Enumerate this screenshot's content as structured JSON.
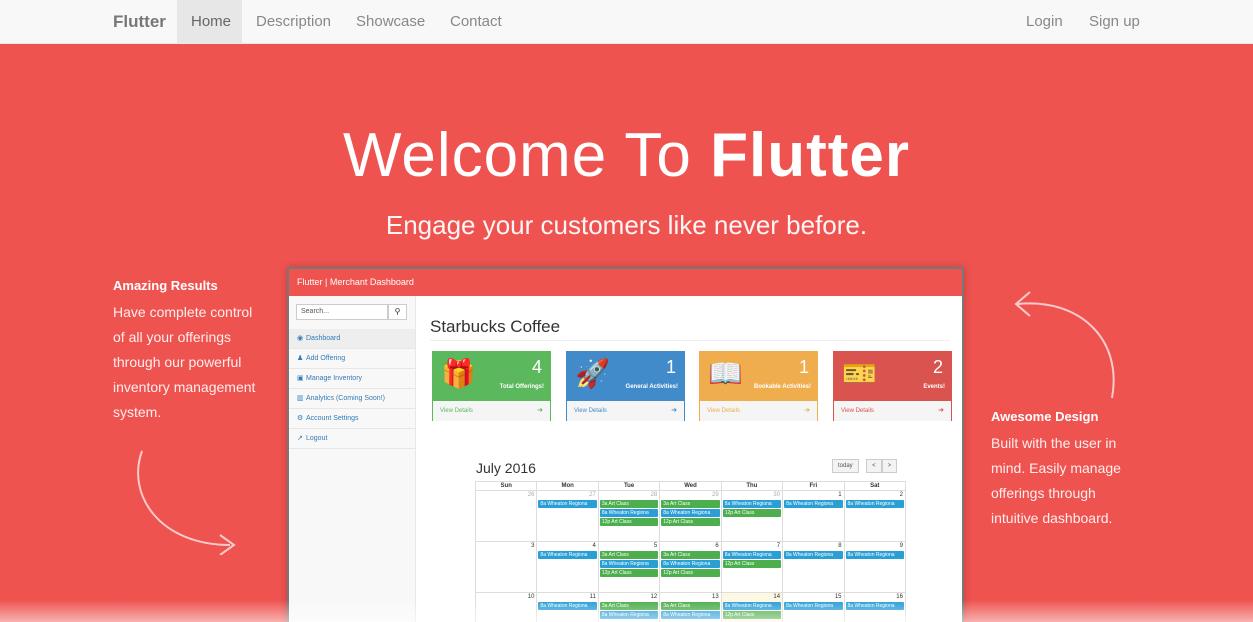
{
  "navbar": {
    "brand": "Flutter",
    "items": [
      "Home",
      "Description",
      "Showcase",
      "Contact"
    ],
    "right": [
      "Login",
      "Sign up"
    ]
  },
  "hero": {
    "title_light": "Welcome To ",
    "title_bold": "Flutter",
    "subtitle": "Engage your customers like never before."
  },
  "left_feature": {
    "title": "Amazing Results",
    "lines": [
      "Have complete control",
      "of all your offerings",
      "through our powerful",
      "inventory management",
      "system."
    ]
  },
  "right_feature": {
    "title": "Awesome Design",
    "lines": [
      "Built with the user in",
      "mind. Easily manage",
      "offerings through",
      "intuitive dashboard."
    ]
  },
  "dashboard": {
    "header": "Flutter | Merchant Dashboard",
    "search_placeholder": "Search...",
    "search_icon": "search-icon",
    "menu": [
      {
        "label": "Dashboard",
        "icon": "dashboard-icon",
        "glyph": "◉"
      },
      {
        "label": "Add Offering",
        "icon": "users-icon",
        "glyph": "♟"
      },
      {
        "label": "Manage Inventory",
        "icon": "truck-icon",
        "glyph": "▣"
      },
      {
        "label": "Analytics (Coming Soon!)",
        "icon": "bar-chart-icon",
        "glyph": "▥"
      },
      {
        "label": "Account Settings",
        "icon": "gears-icon",
        "glyph": "⚙"
      },
      {
        "label": "Logout",
        "icon": "external-link-icon",
        "glyph": "↗"
      }
    ],
    "store_name": "Starbucks Coffee",
    "cards": [
      {
        "count": "4",
        "label": "Total Offerings!",
        "foot": "View Details",
        "icon": "gift-icon",
        "glyph": "🎁",
        "color": "#5cb85c"
      },
      {
        "count": "1",
        "label": "General Activities!",
        "foot": "View Details",
        "icon": "rocket-icon",
        "glyph": "🚀",
        "color": "#428bca"
      },
      {
        "count": "1",
        "label": "Bookable Activities!",
        "foot": "View Details",
        "icon": "book-icon",
        "glyph": "📖",
        "color": "#f0ad4e"
      },
      {
        "count": "2",
        "label": "Events!",
        "foot": "View Details",
        "icon": "ticket-icon",
        "glyph": "🎫",
        "color": "#d9534f"
      }
    ],
    "calendar": {
      "title": "July 2016",
      "today_btn": "today",
      "prev": "<",
      "next": ">",
      "days": [
        "Sun",
        "Mon",
        "Tue",
        "Wed",
        "Thu",
        "Fri",
        "Sat"
      ],
      "weeks": [
        [
          {
            "d": "26",
            "other": true,
            "ev": []
          },
          {
            "d": "27",
            "other": true,
            "ev": [
              [
                "8a Wheaton Regiona",
                "blue"
              ]
            ]
          },
          {
            "d": "28",
            "other": true,
            "ev": [
              [
                "3a Art Class",
                "green"
              ],
              [
                "8a Wheaton Regiona",
                "blue"
              ],
              [
                "12p Art Class",
                "green"
              ]
            ]
          },
          {
            "d": "29",
            "other": true,
            "ev": [
              [
                "3a Art Class",
                "green"
              ],
              [
                "8a Wheaton Regiona",
                "blue"
              ],
              [
                "12p Art Class",
                "green"
              ]
            ]
          },
          {
            "d": "30",
            "other": true,
            "ev": [
              [
                "8a Wheaton Regiona",
                "blue"
              ],
              [
                "12p Art Class",
                "green"
              ]
            ]
          },
          {
            "d": "1",
            "other": false,
            "ev": [
              [
                "8a Wheaton Regiona",
                "blue"
              ]
            ]
          },
          {
            "d": "2",
            "other": false,
            "ev": [
              [
                "8a Wheaton Regiona",
                "blue"
              ]
            ]
          }
        ],
        [
          {
            "d": "3",
            "other": false,
            "ev": []
          },
          {
            "d": "4",
            "other": false,
            "ev": [
              [
                "8a Wheaton Regiona",
                "blue"
              ]
            ]
          },
          {
            "d": "5",
            "other": false,
            "ev": [
              [
                "3a Art Class",
                "green"
              ],
              [
                "8a Wheaton Regiona",
                "blue"
              ],
              [
                "12p Art Class",
                "green"
              ]
            ]
          },
          {
            "d": "6",
            "other": false,
            "ev": [
              [
                "3a Art Class",
                "green"
              ],
              [
                "8a Wheaton Regiona",
                "blue"
              ],
              [
                "12p Art Class",
                "green"
              ]
            ]
          },
          {
            "d": "7",
            "other": false,
            "ev": [
              [
                "8a Wheaton Regiona",
                "blue"
              ],
              [
                "12p Art Class",
                "green"
              ]
            ]
          },
          {
            "d": "8",
            "other": false,
            "ev": [
              [
                "8a Wheaton Regiona",
                "blue"
              ]
            ]
          },
          {
            "d": "9",
            "other": false,
            "ev": [
              [
                "8a Wheaton Regiona",
                "blue"
              ]
            ]
          }
        ],
        [
          {
            "d": "10",
            "other": false,
            "ev": []
          },
          {
            "d": "11",
            "other": false,
            "ev": [
              [
                "8a Wheaton Regiona",
                "blue"
              ]
            ]
          },
          {
            "d": "12",
            "other": false,
            "ev": [
              [
                "3a Art Class",
                "green"
              ],
              [
                "8a Wheaton Regiona",
                "blue"
              ]
            ]
          },
          {
            "d": "13",
            "other": false,
            "ev": [
              [
                "3a Art Class",
                "green"
              ],
              [
                "8a Wheaton Regiona",
                "blue"
              ]
            ]
          },
          {
            "d": "14",
            "other": false,
            "today": true,
            "ev": [
              [
                "8a Wheaton Regiona",
                "blue"
              ],
              [
                "12p Art Class",
                "green"
              ]
            ]
          },
          {
            "d": "15",
            "other": false,
            "ev": [
              [
                "8a Wheaton Regiona",
                "blue"
              ]
            ]
          },
          {
            "d": "16",
            "other": false,
            "ev": [
              [
                "8a Wheaton Regiona",
                "blue"
              ]
            ]
          }
        ]
      ]
    }
  }
}
